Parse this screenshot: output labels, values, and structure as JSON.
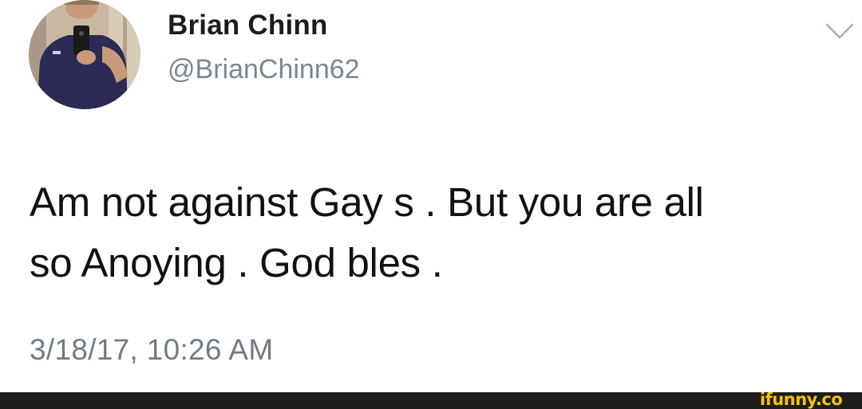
{
  "tweet": {
    "author": {
      "display_name": "Brian Chinn",
      "handle": "@BrianChinn62",
      "avatar_icon": "profile-photo"
    },
    "text_lines": [
      "Am not against Gay s . But you are all",
      "so Anoying . God bles ."
    ],
    "timestamp": "3/18/17, 10:26 AM",
    "menu_icon": "chevron-down-icon"
  },
  "footer": {
    "watermark": "ifunny.co",
    "watermark_color": "#f5c400",
    "bar_color": "#1e1e1e"
  },
  "colors": {
    "name_text": "#1c1c1c",
    "handle_text": "#7a8791",
    "body_text": "#111111",
    "timestamp_text": "#707b84",
    "chevron": "#9fb0bd"
  }
}
